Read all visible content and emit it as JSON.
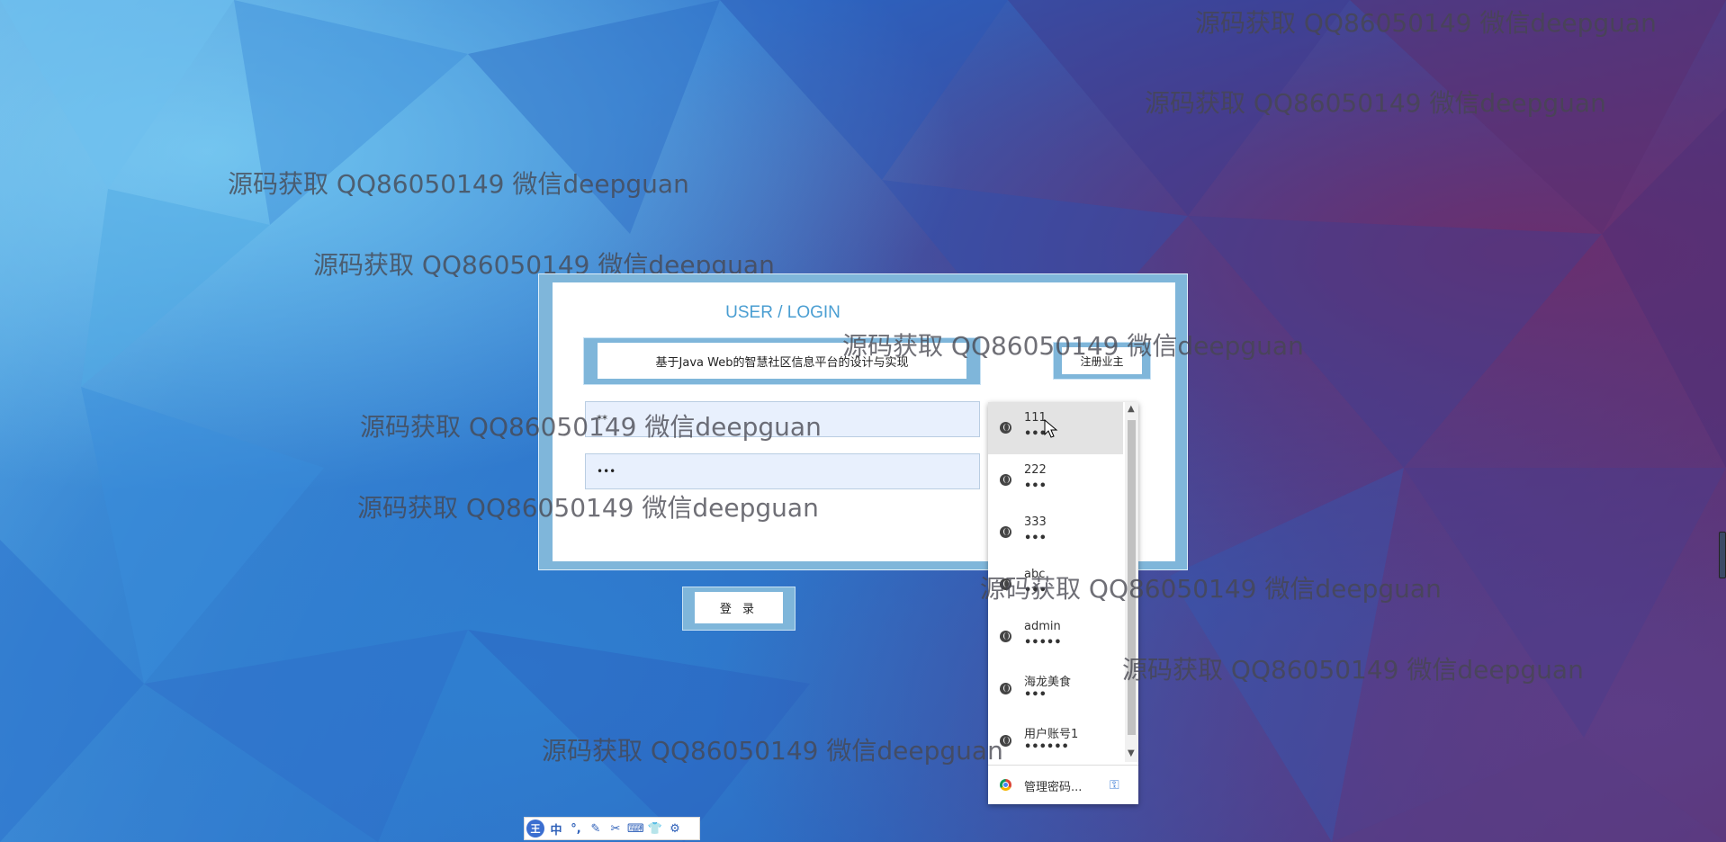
{
  "background": {
    "accent_colors": [
      "#4ea6e3",
      "#2f6fc8",
      "#44408f",
      "#5b2f6b"
    ]
  },
  "watermark_text": "源码获取 QQ86050149 微信deepguan",
  "login": {
    "title": "USER / LOGIN",
    "system_title": "基于Java Web的智慧社区信息平台的设计与实现",
    "register_label": "注册业主",
    "username_value": "**",
    "password_value": "•••",
    "login_label": "登 录"
  },
  "autofill": {
    "items": [
      {
        "user": "111",
        "pass": "•••"
      },
      {
        "user": "222",
        "pass": "•••"
      },
      {
        "user": "333",
        "pass": "•••"
      },
      {
        "user": "abc",
        "pass": "•••"
      },
      {
        "user": "admin",
        "pass": "•••••"
      },
      {
        "user": "海龙美食",
        "pass": "•••"
      },
      {
        "user": "用户账号1",
        "pass": "••••••"
      }
    ],
    "manage_label": "管理密码...",
    "globe_icon": "globe-icon",
    "chrome_icon": "chrome-icon",
    "key_icon": "key-icon"
  },
  "ime": {
    "logo": "王",
    "buttons": [
      "中",
      "°,",
      "✎",
      "✂",
      "⌨",
      "👕",
      "⚙"
    ]
  }
}
